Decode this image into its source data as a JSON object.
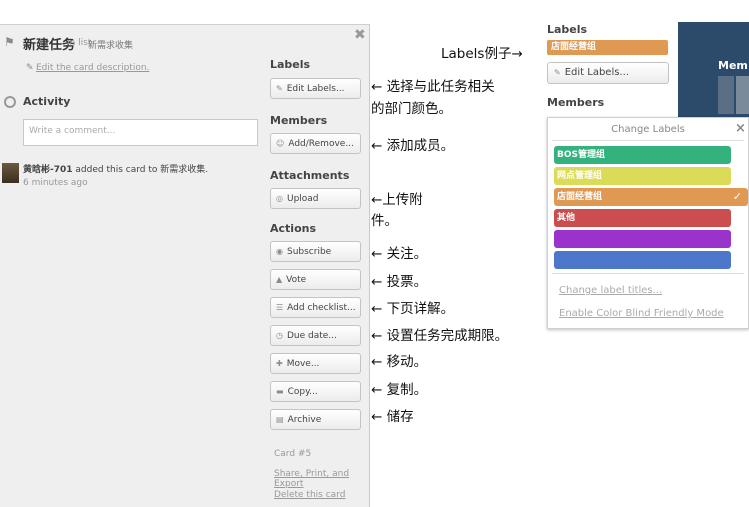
{
  "card": {
    "title": "新建任务",
    "in_list_prefix": "in list",
    "list_name": "新需求收集",
    "edit_description": "Edit the card description.",
    "activity_heading": "Activity",
    "comment_placeholder": "Write a comment...",
    "activity_user": "黄晗彬-701",
    "activity_text": "added this card to",
    "activity_list": "新需求收集.",
    "activity_time": "6 minutes ago",
    "card_number": "Card #5",
    "share_link": "Share, Print, and Export",
    "delete_link": "Delete this card"
  },
  "sidebar": {
    "labels_heading": "Labels",
    "members_heading": "Members",
    "attachments_heading": "Attachments",
    "actions_heading": "Actions",
    "buttons": {
      "edit_labels": "Edit Labels...",
      "add_remove": "Add/Remove...",
      "upload": "Upload",
      "subscribe": "Subscribe",
      "vote": "Vote",
      "add_checklist": "Add checklist...",
      "due_date": "Due date...",
      "move": "Move...",
      "copy": "Copy...",
      "archive": "Archive"
    }
  },
  "annotations": {
    "labels_example": "Labels例子→",
    "labels_line1": "← 选择与此任务相关",
    "labels_line2": "的部门颜色。",
    "members": "← 添加成员。",
    "attach_line1": "←上传附",
    "attach_line2": "件。",
    "subscribe": "← 关注。",
    "vote": "← 投票。",
    "checklist": "← 下页详解。",
    "due": "← 设置任务完成期限。",
    "move": "←  移动。",
    "copy": "← 复制。",
    "archive": "← 储存"
  },
  "example_panel": {
    "labels_heading": "Labels",
    "label_chip": "店面经营组",
    "edit_labels": "Edit Labels...",
    "members_heading": "Members",
    "bg_text": "Mem"
  },
  "change_labels": {
    "title": "Change Labels",
    "close": "×",
    "labels": [
      {
        "name": "BOS管理组",
        "color": "#34b27d"
      },
      {
        "name": "网点管理组",
        "color": "#dbdb57"
      },
      {
        "name": "店面经营组",
        "color": "#e09952",
        "checked": true
      },
      {
        "name": "其他",
        "color": "#cb4d4d"
      },
      {
        "name": "",
        "color": "#9933cc"
      },
      {
        "name": "",
        "color": "#4d77cb"
      }
    ],
    "check_mark": "✓",
    "change_titles": "Change label titles...",
    "color_blind": "Enable Color Blind Friendly Mode"
  }
}
